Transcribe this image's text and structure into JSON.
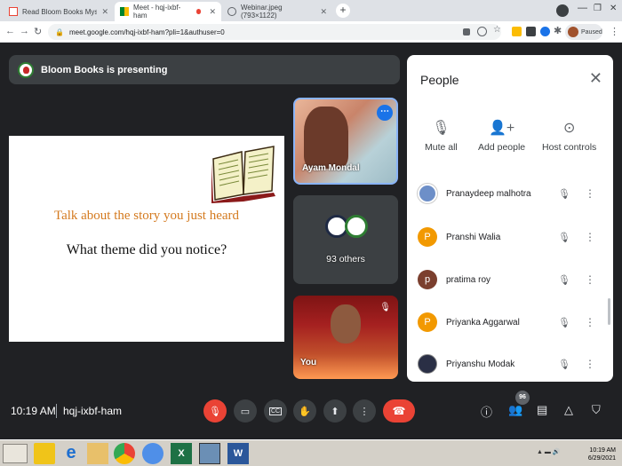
{
  "browser": {
    "tabs": [
      {
        "title": "Read Bloom Books Mystery Read"
      },
      {
        "title": "Meet - hqj-ixbf-ham"
      },
      {
        "title": "Webinar.jpeg (793×1122)"
      }
    ],
    "url": "meet.google.com/hqj-ixbf-ham?pli=1&authuser=0",
    "profile_status": "Paused"
  },
  "meet": {
    "presenting_label": "Bloom Books is presenting",
    "slide": {
      "line1": "Talk about the story you just heard",
      "line2": "What theme did you notice?"
    },
    "tiles": [
      {
        "name": "Ayam Mondal"
      },
      {
        "name": "93 others"
      },
      {
        "name": "You"
      }
    ],
    "time": "10:19 AM",
    "meeting_code": "hqj-ixbf-ham",
    "participant_count": "96"
  },
  "people": {
    "title": "People",
    "actions": {
      "mute_all": "Mute all",
      "add_people": "Add people",
      "host_controls": "Host controls"
    },
    "list": [
      {
        "name": "Pranaydeep malhotra",
        "initial": "",
        "color": "#6d8fc8"
      },
      {
        "name": "Pranshi Walia",
        "initial": "P",
        "color": "#f29900"
      },
      {
        "name": "pratima roy",
        "initial": "p",
        "color": "#7b3f2e"
      },
      {
        "name": "Priyanka Aggarwal",
        "initial": "P",
        "color": "#f29900"
      },
      {
        "name": "Priyanshu Modak",
        "initial": "",
        "color": "#2a2f45"
      }
    ]
  },
  "taskbar": {
    "time": "10:19 AM",
    "date": "6/29/2021"
  }
}
